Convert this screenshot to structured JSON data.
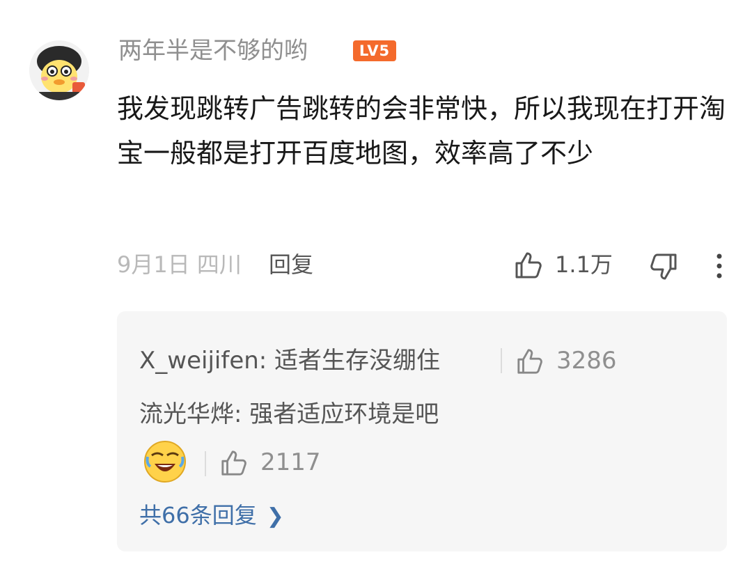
{
  "comment": {
    "username": "两年半是不够的哟",
    "level_badge": "LV5",
    "text": "我发现跳转广告跳转的会非常快，所以我现在打开淘宝一般都是打开百度地图，效率高了不少",
    "date_location": "9月1日 四川",
    "reply_label": "回复",
    "like_count": "1.1万",
    "icons": {
      "avatar": "cartoon-avatar",
      "like": "thumbs-up-icon",
      "dislike": "thumbs-down-icon",
      "more": "more-vertical-icon"
    }
  },
  "replies": {
    "items": [
      {
        "author": "X_weijifen",
        "text": "适者生存没绷住",
        "likes": "3286"
      },
      {
        "author": "流光华烨",
        "text": "强者适应环境是吧",
        "likes": "2117"
      }
    ],
    "reply_1_full": "X_weijifen: 适者生存没绷住",
    "reply_2_full": "流光华烨: 强者适应环境是吧",
    "more_label": "共66条回复",
    "emoji_icon": "laughing-emoji",
    "colors": {
      "panel_bg": "#f6f6f6",
      "link": "#3f6fa8",
      "badge": "#f46a2c"
    }
  }
}
